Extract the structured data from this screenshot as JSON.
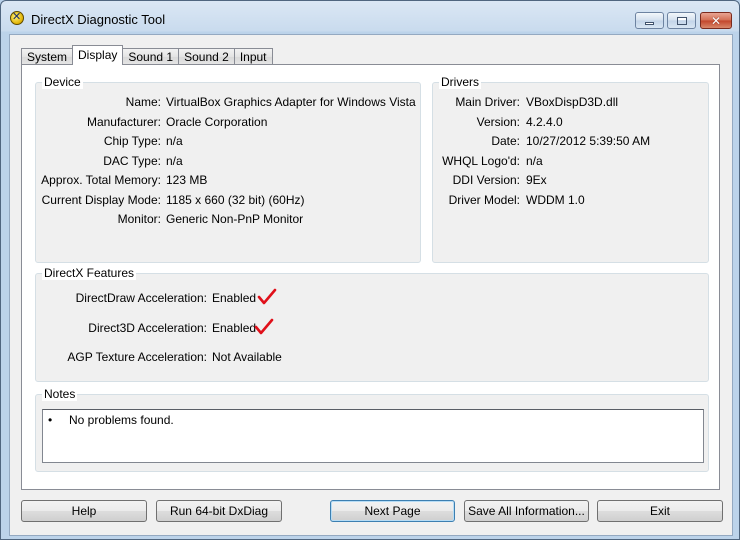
{
  "window": {
    "title": "DirectX Diagnostic Tool"
  },
  "tabs": [
    {
      "label": "System",
      "active": false
    },
    {
      "label": "Display",
      "active": true
    },
    {
      "label": "Sound 1",
      "active": false
    },
    {
      "label": "Sound 2",
      "active": false
    },
    {
      "label": "Input",
      "active": false
    }
  ],
  "device": {
    "title": "Device",
    "rows": [
      {
        "label": "Name:",
        "value": "VirtualBox Graphics Adapter for Windows Vista"
      },
      {
        "label": "Manufacturer:",
        "value": "Oracle Corporation"
      },
      {
        "label": "Chip Type:",
        "value": "n/a"
      },
      {
        "label": "DAC Type:",
        "value": "n/a"
      },
      {
        "label": "Approx. Total Memory:",
        "value": "123 MB"
      },
      {
        "label": "Current Display Mode:",
        "value": "1185 x 660 (32 bit) (60Hz)"
      },
      {
        "label": "Monitor:",
        "value": "Generic Non-PnP Monitor"
      }
    ]
  },
  "drivers": {
    "title": "Drivers",
    "rows": [
      {
        "label": "Main Driver:",
        "value": "VBoxDispD3D.dll"
      },
      {
        "label": "Version:",
        "value": "4.2.4.0"
      },
      {
        "label": "Date:",
        "value": "10/27/2012 5:39:50 AM"
      },
      {
        "label": "WHQL Logo'd:",
        "value": "n/a"
      },
      {
        "label": "DDI Version:",
        "value": "9Ex"
      },
      {
        "label": "Driver Model:",
        "value": "WDDM 1.0"
      }
    ]
  },
  "features": {
    "title": "DirectX Features",
    "rows": [
      {
        "label": "DirectDraw Acceleration:",
        "value": "Enabled",
        "check": true
      },
      {
        "label": "Direct3D Acceleration:",
        "value": "Enabled",
        "check": true
      },
      {
        "label": "AGP Texture Acceleration:",
        "value": "Not Available",
        "check": false
      }
    ]
  },
  "notes": {
    "title": "Notes",
    "bullet": "•",
    "text": "No problems found."
  },
  "buttons": {
    "help": "Help",
    "run64": "Run 64-bit DxDiag",
    "next": "Next Page",
    "save": "Save All Information...",
    "exit": "Exit"
  },
  "colors": {
    "check": "#e0101a"
  }
}
